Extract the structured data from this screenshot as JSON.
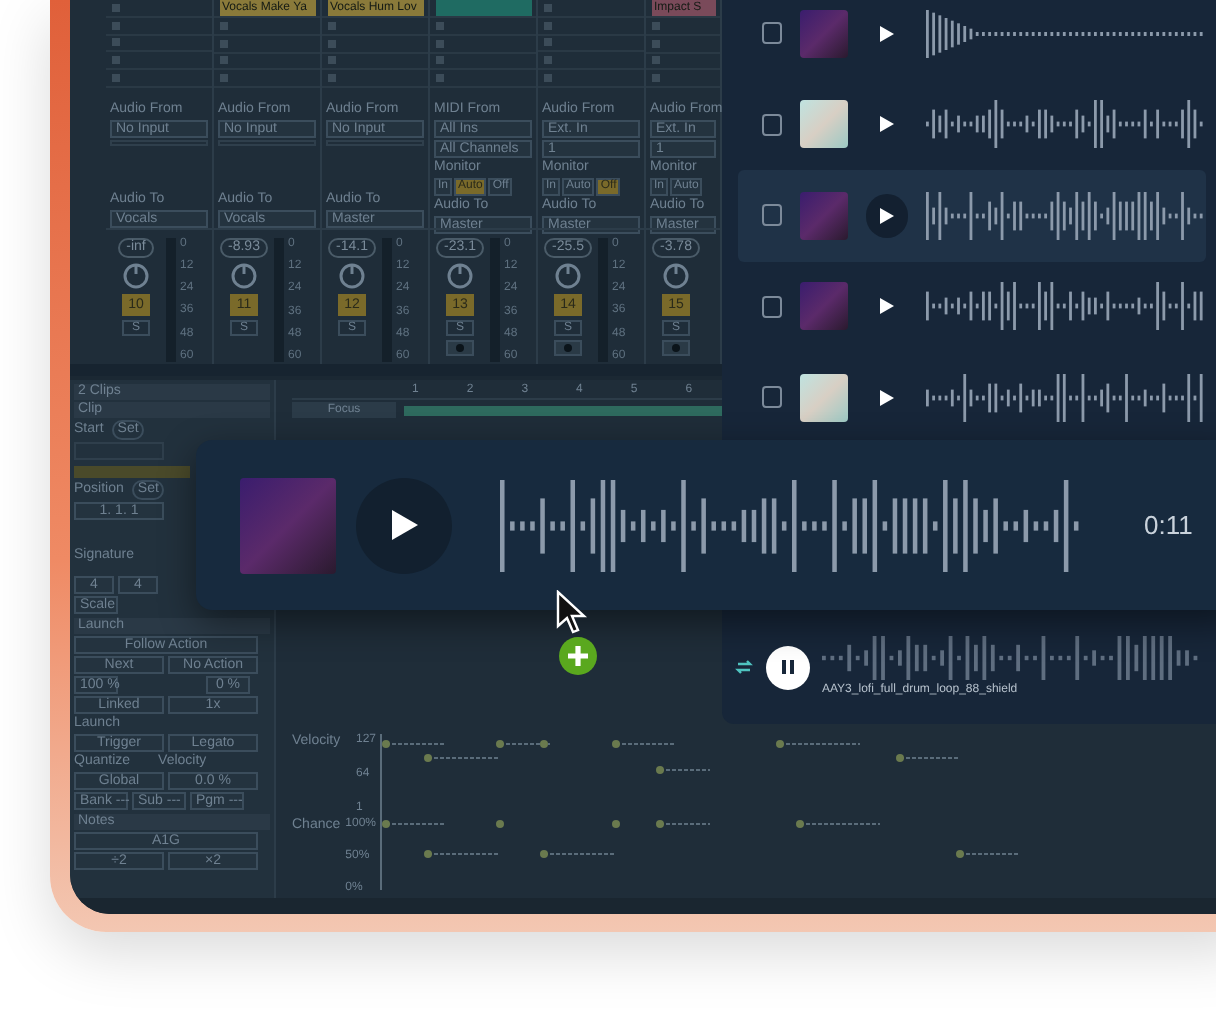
{
  "mixer": {
    "channels": [
      {
        "from_label": "Audio From",
        "from": "No Input",
        "to_label": "Audio To",
        "to": "Vocals",
        "volume": "-inf",
        "number": "10",
        "solo": "S",
        "armed": false,
        "scale": [
          "0",
          "12",
          "24",
          "36",
          "48",
          "60"
        ]
      },
      {
        "clip": {
          "name": "Vocals Make Ya",
          "color": "#8a7a3a"
        },
        "from_label": "Audio From",
        "from": "No Input",
        "to_label": "Audio To",
        "to": "Vocals",
        "volume": "-8.93",
        "number": "11",
        "solo": "S",
        "armed": false,
        "scale": [
          "0",
          "12",
          "24",
          "36",
          "48",
          "60"
        ]
      },
      {
        "clip": {
          "name": "Vocals Hum Lov",
          "color": "#8a7a3a"
        },
        "from_label": "Audio From",
        "from": "No Input",
        "to_label": "Audio To",
        "to": "Master",
        "volume": "-14.1",
        "number": "12",
        "solo": "S",
        "armed": false,
        "scale": [
          "0",
          "12",
          "24",
          "36",
          "48",
          "60"
        ]
      },
      {
        "clip": {
          "color": "#1f6b62"
        },
        "from_label": "MIDI From",
        "from": "All Ins",
        "sub": "All Channels",
        "monitor": {
          "label": "Monitor",
          "options": [
            {
              "label": "In",
              "selected": false
            },
            {
              "label": "Auto",
              "selected": true
            },
            {
              "label": "Off",
              "selected": false
            }
          ]
        },
        "to_label": "Audio To",
        "to": "Master",
        "volume": "-23.1",
        "number": "13",
        "solo": "S",
        "armed": true,
        "scale": [
          "0",
          "12",
          "24",
          "36",
          "48",
          "60"
        ]
      },
      {
        "from_label": "Audio From",
        "from": "Ext. In",
        "sub": "1",
        "monitor": {
          "label": "Monitor",
          "options": [
            {
              "label": "In",
              "selected": false
            },
            {
              "label": "Auto",
              "selected": false
            },
            {
              "label": "Off",
              "selected": true
            }
          ]
        },
        "to_label": "Audio To",
        "to": "Master",
        "volume": "-25.5",
        "number": "14",
        "solo": "S",
        "armed": true,
        "scale": [
          "0",
          "12",
          "24",
          "36",
          "48",
          "60"
        ]
      },
      {
        "clip": {
          "name": "Impact S",
          "color": "#7a4a5a"
        },
        "from_label": "Audio From",
        "from": "Ext. In",
        "sub": "1",
        "monitor": {
          "label": "Monitor",
          "options": [
            {
              "label": "In",
              "selected": false
            },
            {
              "label": "Auto",
              "selected": false
            }
          ]
        },
        "to_label": "Audio To",
        "to": "Master",
        "volume": "-3.78",
        "number": "15",
        "solo": "S",
        "armed": true
      }
    ]
  },
  "clip_panel": {
    "header": "2 Clips",
    "section": "Clip",
    "start": "Start",
    "set": "Set",
    "position": "Position",
    "set_2": "Set",
    "position_value": "1.  1.  1",
    "signature": "Signature",
    "sig_num": "4",
    "sig_den": "4",
    "scale": "Scale",
    "launch": "Launch",
    "follow_action": "Follow Action",
    "next": "Next",
    "no_action": "No Action",
    "chance_a": "100 %",
    "chance_b": "0 %",
    "linked": "Linked",
    "times": "1x",
    "launch_label": "Launch",
    "trigger": "Trigger",
    "legato": "Legato",
    "quantize": "Quantize",
    "velocity": "Velocity",
    "global": "Global",
    "velocity_value": "0.0 %",
    "bank": "Bank ---",
    "sub": "Sub ---",
    "pgm": "Pgm ---",
    "notes": "Notes",
    "note_range": "A1G",
    "halve": "÷2",
    "double": "×2"
  },
  "editor": {
    "focus": "Focus",
    "ruler": [
      "1",
      "2",
      "3",
      "4",
      "5",
      "6"
    ],
    "velocity_label": "Velocity",
    "velocity_ticks": [
      "127",
      "64",
      "1"
    ],
    "chance_label": "Chance",
    "chance_ticks": [
      "100%",
      "50%",
      "0%"
    ]
  },
  "library": {
    "rows": [
      {
        "kind": "neon",
        "checked": false,
        "selected": false
      },
      {
        "kind": "poster",
        "checked": false,
        "selected": false
      },
      {
        "kind": "neon",
        "checked": false,
        "selected": true
      },
      {
        "kind": "neon",
        "checked": false,
        "selected": false
      },
      {
        "kind": "poster",
        "checked": false,
        "selected": false
      }
    ]
  },
  "drag_card": {
    "kind": "neon",
    "time": "0:11"
  },
  "player": {
    "playing": true,
    "filename": "AAY3_lofi_full_drum_loop_88_shield"
  }
}
